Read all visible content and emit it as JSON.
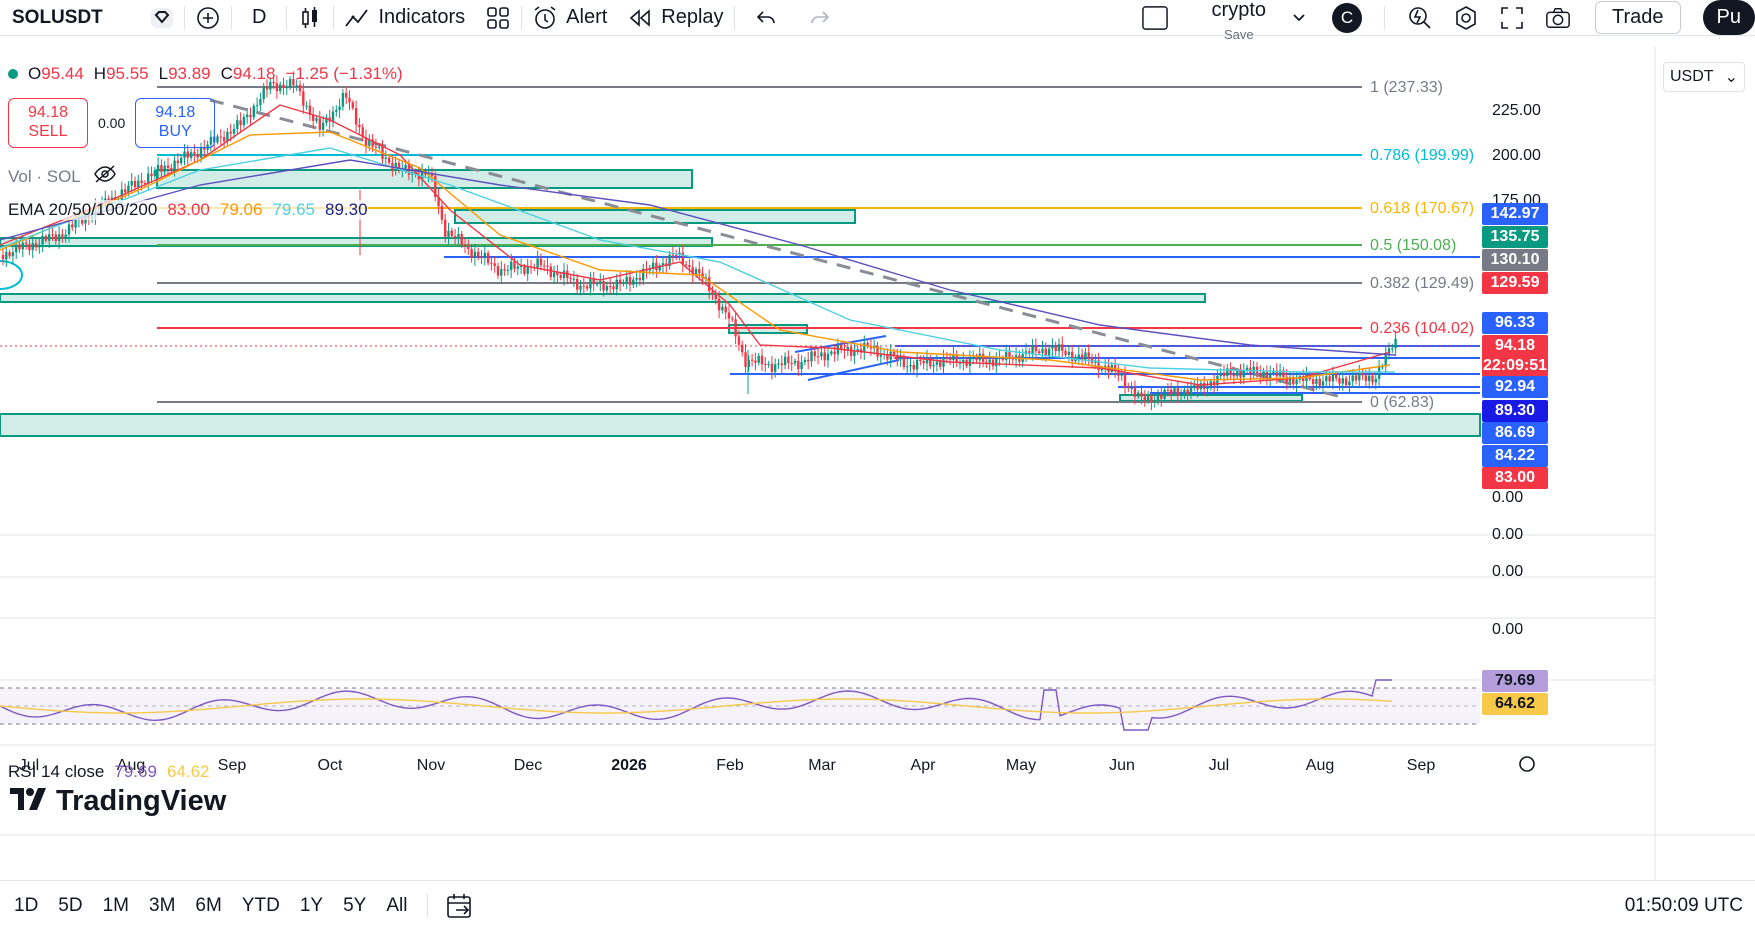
{
  "toolbar": {
    "symbol": "SOLUSDT",
    "interval": "D",
    "indicators": "Indicators",
    "alert": "Alert",
    "replay": "Replay",
    "layout_name": "crypto",
    "layout_save": "Save",
    "avatar": "C",
    "trade": "Trade",
    "publish": "Pu"
  },
  "legend": {
    "open_label": "O",
    "open": "95.44",
    "high_label": "H",
    "high": "95.55",
    "low_label": "L",
    "low": "93.89",
    "close_label": "C",
    "close": "94.18",
    "change": "−1.25 (−1.31%)",
    "sell_price": "94.18",
    "sell_label": "SELL",
    "spread": "0.00",
    "buy_price": "94.18",
    "buy_label": "BUY",
    "vol": "Vol · SOL",
    "ema_name": "EMA 20/50/100/200",
    "ema20": "83.00",
    "ema50": "79.06",
    "ema100": "79.65",
    "ema200": "89.30",
    "rsi_name": "RSI 14 close",
    "rsi": "79.69",
    "rsi_ma": "64.62"
  },
  "currency": "USDT",
  "fib_levels": [
    {
      "text": "1 (237.33)",
      "color": "#787b86"
    },
    {
      "text": "0.786 (199.99)",
      "color": "#00bcd4"
    },
    {
      "text": "0.618 (170.67)",
      "color": "#f7b500"
    },
    {
      "text": "0.5 (150.08)",
      "color": "#4caf50"
    },
    {
      "text": "0.382 (129.49)",
      "color": "#787b86"
    },
    {
      "text": "0.236 (104.02)",
      "color": "#f23645"
    },
    {
      "text": "0 (62.83)",
      "color": "#787b86"
    }
  ],
  "price_axis": [
    "225.00",
    "200.00",
    "175.00"
  ],
  "price_tags": [
    {
      "text": "142.97",
      "color": "#2962ff"
    },
    {
      "text": "135.75",
      "color": "#089981"
    },
    {
      "text": "130.10",
      "color": "#787b86"
    },
    {
      "text": "129.59",
      "color": "#f23645"
    },
    {
      "text": "96.33",
      "color": "#2962ff"
    },
    {
      "text": "94.18",
      "color": "#f23645"
    },
    {
      "text": "22:09:51",
      "color": "#f23645"
    },
    {
      "text": "92.94",
      "color": "#2962ff"
    },
    {
      "text": "89.30",
      "color": "#1a1ae6"
    },
    {
      "text": "86.69",
      "color": "#2962ff"
    },
    {
      "text": "84.22",
      "color": "#2962ff"
    },
    {
      "text": "83.00",
      "color": "#f23645"
    }
  ],
  "pane_zero_labels": [
    "0.00",
    "0.00",
    "0.00",
    "0.00"
  ],
  "rsi_tags": [
    {
      "text": "79.69",
      "color": "#b39ddb"
    },
    {
      "text": "64.62",
      "color": "#f7c948"
    }
  ],
  "time_axis": [
    "Jul",
    "Aug",
    "Sep",
    "Oct",
    "Nov",
    "Dec",
    "2026",
    "Feb",
    "Mar",
    "Apr",
    "May",
    "Jun",
    "Jul",
    "Aug",
    "Sep"
  ],
  "ranges": [
    "1D",
    "5D",
    "1M",
    "3M",
    "6M",
    "YTD",
    "1Y",
    "5Y",
    "All"
  ],
  "clock": "01:50:09 UTC",
  "logo": "TradingView",
  "chart_data": {
    "type": "candlestick",
    "price_ylim": [
      55,
      245
    ],
    "series_close_approx": [
      {
        "month": "Jul",
        "value": 150
      },
      {
        "month": "Aug",
        "value": 175
      },
      {
        "month": "Sep",
        "value": 210
      },
      {
        "month": "Oct",
        "value": 215
      },
      {
        "month": "Nov",
        "value": 175
      },
      {
        "month": "Dec",
        "value": 135
      },
      {
        "month": "2026",
        "value": 138
      },
      {
        "month": "Feb",
        "value": 95
      },
      {
        "month": "Mar",
        "value": 90
      },
      {
        "month": "Apr",
        "value": 82
      },
      {
        "month": "May",
        "value": 88
      },
      {
        "month": "Jun",
        "value": 70
      },
      {
        "month": "Jul",
        "value": 80
      },
      {
        "month": "Aug",
        "value": 80
      },
      {
        "month": "Sep",
        "value": 94.18
      }
    ],
    "rsi_ylim": [
      20,
      90
    ]
  }
}
